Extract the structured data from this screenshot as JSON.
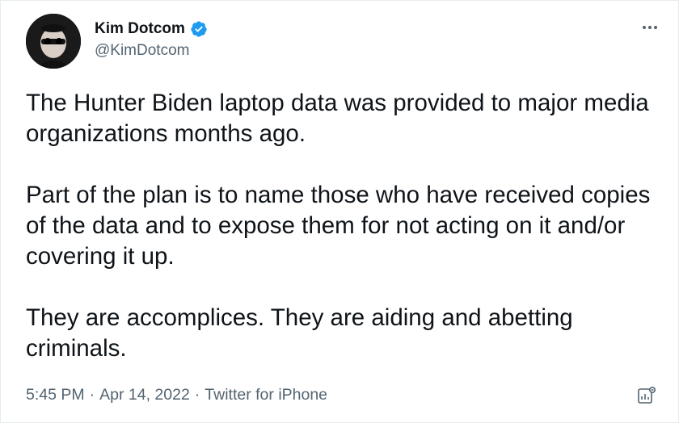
{
  "author": {
    "display_name": "Kim Dotcom",
    "handle": "@KimDotcom",
    "verified_icon": "verified-badge-icon"
  },
  "tweet": {
    "paragraphs": [
      "The Hunter Biden laptop data was provided to major media organizations months ago.",
      "Part of the plan is to name those who have received copies of the data and to expose them for not acting on it and/or covering it up.",
      "They are accomplices. They are aiding and abetting criminals."
    ]
  },
  "meta": {
    "time": "5:45 PM",
    "date": "Apr 14, 2022",
    "source": "Twitter for iPhone",
    "separator": "·"
  },
  "icons": {
    "more": "more-options-icon",
    "analytics": "analytics-icon"
  },
  "colors": {
    "verified": "#1d9bf0",
    "text": "#0f1419",
    "secondary": "#536471"
  }
}
